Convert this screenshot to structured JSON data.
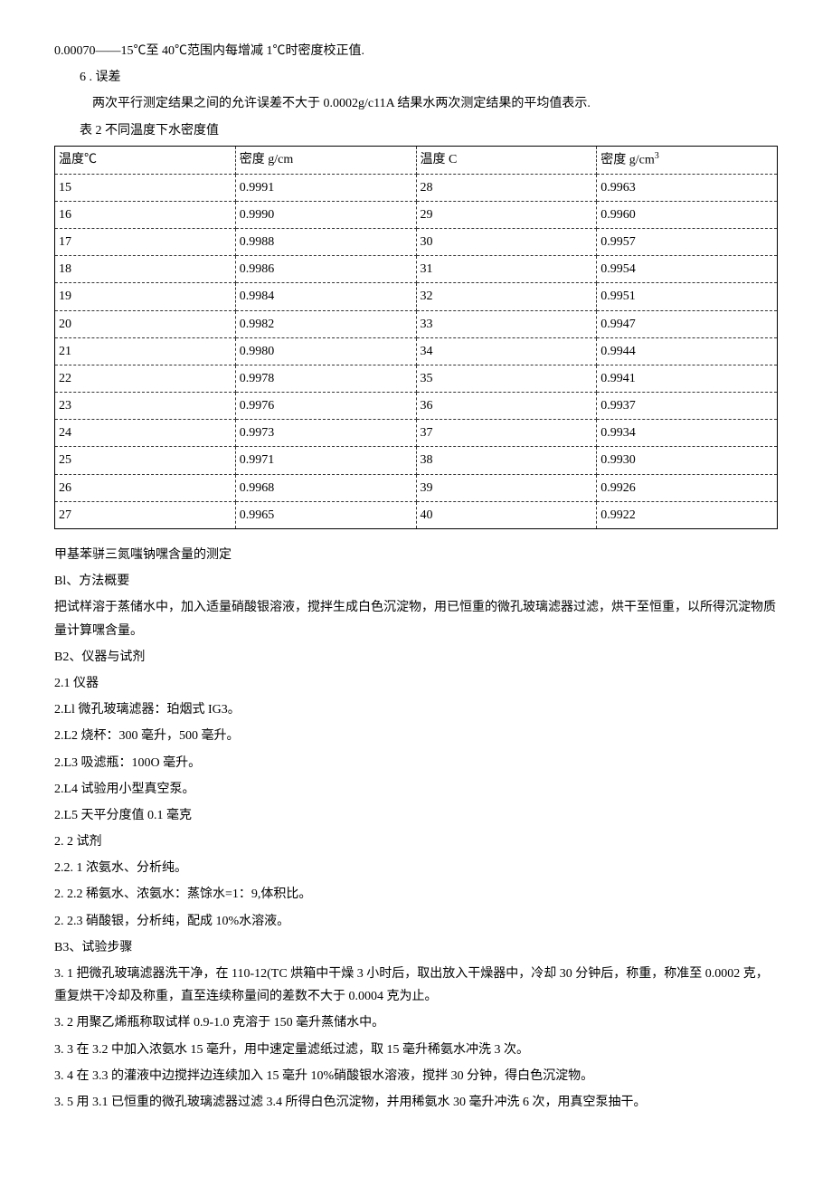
{
  "note1": "0.00070——15℃至 40℃范围内每增减 1℃时密度校正值.",
  "sec6_heading": "6 . 误差",
  "sec6_text": "两次平行测定结果之间的允许误差不大于 0.0002g/c11A 结果水两次测定结果的平均值表示.",
  "table_caption": "表 2 不同温度下水密度值",
  "table": {
    "headers": [
      "温度℃",
      "密度 g/cm",
      "温度 C",
      "密度 g/cm³"
    ],
    "rows": [
      [
        "15",
        "0.9991",
        "28",
        "0.9963"
      ],
      [
        "16",
        "0.9990",
        "29",
        "0.9960"
      ],
      [
        "17",
        "0.9988",
        "30",
        "0.9957"
      ],
      [
        "18",
        "0.9986",
        "31",
        "0.9954"
      ],
      [
        "19",
        "0.9984",
        "32",
        "0.9951"
      ],
      [
        "20",
        "0.9982",
        "33",
        "0.9947"
      ],
      [
        "21",
        "0.9980",
        "34",
        "0.9944"
      ],
      [
        "22",
        "0.9978",
        "35",
        "0.9941"
      ],
      [
        "23",
        "0.9976",
        "36",
        "0.9937"
      ],
      [
        "24",
        "0.9973",
        "37",
        "0.9934"
      ],
      [
        "25",
        "0.9971",
        "38",
        "0.9930"
      ],
      [
        "26",
        "0.9968",
        "39",
        "0.9926"
      ],
      [
        "27",
        "0.9965",
        "40",
        "0.9922"
      ]
    ]
  },
  "chart_data": {
    "type": "table",
    "title": "表 2 不同温度下水密度值",
    "columns": [
      "温度℃",
      "密度 g/cm",
      "温度 C",
      "密度 g/cm³"
    ],
    "data": [
      {
        "temp1": 15,
        "dens1": 0.9991,
        "temp2": 28,
        "dens2": 0.9963
      },
      {
        "temp1": 16,
        "dens1": 0.999,
        "temp2": 29,
        "dens2": 0.996
      },
      {
        "temp1": 17,
        "dens1": 0.9988,
        "temp2": 30,
        "dens2": 0.9957
      },
      {
        "temp1": 18,
        "dens1": 0.9986,
        "temp2": 31,
        "dens2": 0.9954
      },
      {
        "temp1": 19,
        "dens1": 0.9984,
        "temp2": 32,
        "dens2": 0.9951
      },
      {
        "temp1": 20,
        "dens1": 0.9982,
        "temp2": 33,
        "dens2": 0.9947
      },
      {
        "temp1": 21,
        "dens1": 0.998,
        "temp2": 34,
        "dens2": 0.9944
      },
      {
        "temp1": 22,
        "dens1": 0.9978,
        "temp2": 35,
        "dens2": 0.9941
      },
      {
        "temp1": 23,
        "dens1": 0.9976,
        "temp2": 36,
        "dens2": 0.9937
      },
      {
        "temp1": 24,
        "dens1": 0.9973,
        "temp2": 37,
        "dens2": 0.9934
      },
      {
        "temp1": 25,
        "dens1": 0.9971,
        "temp2": 38,
        "dens2": 0.993
      },
      {
        "temp1": 26,
        "dens1": 0.9968,
        "temp2": 39,
        "dens2": 0.9926
      },
      {
        "temp1": 27,
        "dens1": 0.9965,
        "temp2": 40,
        "dens2": 0.9922
      }
    ]
  },
  "section_title": "甲基苯骈三氮嗤钠嘿含量的测定",
  "b1_heading": "Bl、方法概要",
  "b1_text": "把试样溶于蒸储水中，加入适量硝酸银溶液，搅拌生成白色沉淀物，用已恒重的微孔玻璃滤器过滤，烘干至恒重，以所得沉淀物质量计算嘿含量。",
  "b2_heading": "B2、仪器与试剂",
  "b2_1": "2.1 仪器",
  "b2_l1": "2.Ll 微孔玻璃滤器：珀烟式 IG3。",
  "b2_l2": "2.L2 烧杯：300 毫升，500 毫升。",
  "b2_l3": "2.L3 吸滤瓶：100O 毫升。",
  "b2_l4": "2.L4 试验用小型真空泵。",
  "b2_l5": "2.L5 天平分度值 0.1 毫克",
  "b2_2": "2. 2 试剂",
  "b2_2_1": "2.2. 1 浓氨水、分析纯。",
  "b2_2_2": "2. 2.2 稀氨水、浓氨水：蒸馀水=1：9,体积比。",
  "b2_2_3": "2. 2.3 硝酸银，分析纯，配成 10%水溶液。",
  "b3_heading": "B3、试验步骤",
  "b3_1": "3. 1 把微孔玻璃滤器洗干净，在 110-12(TC 烘箱中干燥 3 小时后，取出放入干燥器中，冷却 30 分钟后，称重，称准至 0.0002 克，重复烘干冷却及称重，直至连续称量间的差数不大于 0.0004 克为止。",
  "b3_2": "3. 2 用聚乙烯瓶称取试样 0.9-1.0 克溶于 150 毫升蒸储水中。",
  "b3_3": "3. 3 在 3.2 中加入浓氨水 15 毫升，用中速定量滤纸过滤，取 15 毫升稀氨水冲洗 3 次。",
  "b3_4": "3. 4 在 3.3 的灌液中边搅拌边连续加入 15 毫升 10%硝酸银水溶液，搅拌 30 分钟，得白色沉淀物。",
  "b3_5": "3. 5 用 3.1 已恒重的微孔玻璃滤器过滤 3.4 所得白色沉淀物，并用稀氨水 30 毫升冲洗 6 次，用真空泵抽干。"
}
